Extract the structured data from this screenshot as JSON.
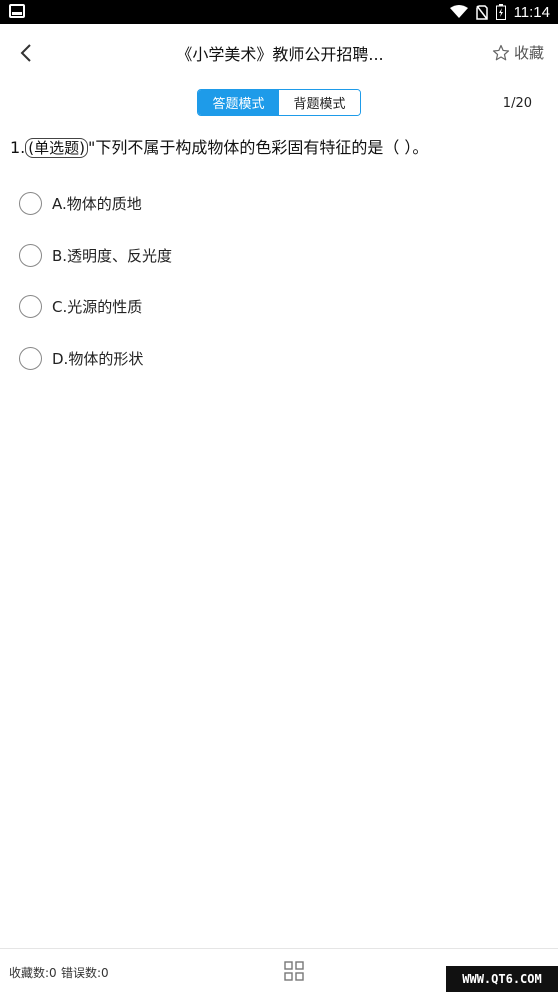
{
  "status_bar": {
    "time": "11:14"
  },
  "header": {
    "title": "《小学美术》教师公开招聘...",
    "favorite_label": "收藏"
  },
  "mode": {
    "answer_mode": "答题模式",
    "recite_mode": "背题模式",
    "active": "answer_mode"
  },
  "progress": "1/20",
  "question": {
    "number": "1.",
    "type": "(单选题)",
    "text": "\"下列不属于构成物体的色彩固有特征的是（ ）。"
  },
  "options": [
    {
      "label": "A.物体的质地"
    },
    {
      "label": "B.透明度、反光度"
    },
    {
      "label": "C.光源的性质"
    },
    {
      "label": "D.物体的形状"
    }
  ],
  "bottom": {
    "favorites_count": "收藏数:0",
    "errors_count": "错误数:0",
    "watermark": "WWW.QT6.COM"
  },
  "colors": {
    "accent": "#1e9be9"
  }
}
